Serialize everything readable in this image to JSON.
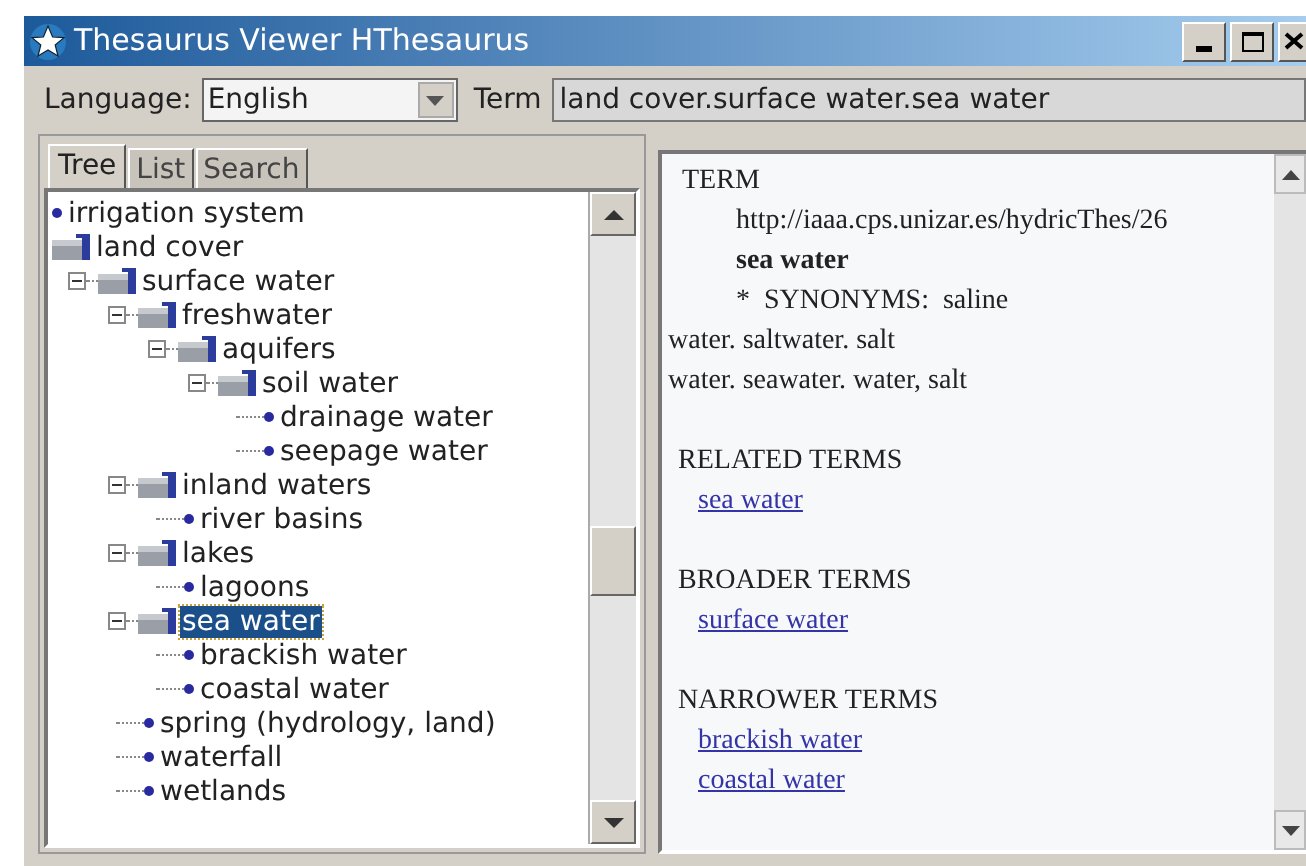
{
  "window": {
    "title": "Thesaurus Viewer HThesaurus"
  },
  "toolbar": {
    "language_label": "Language:",
    "language": "English",
    "term_label": "Term",
    "term": "land cover.surface water.sea water"
  },
  "tabs": [
    {
      "label": "Tree",
      "selected": true
    },
    {
      "label": "List",
      "selected": false
    },
    {
      "label": "Search",
      "selected": false
    }
  ],
  "tree": [
    {
      "label": "irrigation system",
      "kind": "leaf",
      "selected": false
    },
    {
      "label": "land cover",
      "kind": "folder",
      "selected": false,
      "children": [
        {
          "label": "surface water",
          "kind": "folder",
          "expanded": true,
          "selected": false,
          "children": [
            {
              "label": "freshwater",
              "kind": "folder",
              "expanded": true,
              "selected": false,
              "children": [
                {
                  "label": "aquifers",
                  "kind": "folder",
                  "expanded": true,
                  "selected": false,
                  "children": [
                    {
                      "label": "soil water",
                      "kind": "folder",
                      "expanded": true,
                      "selected": false,
                      "children": [
                        {
                          "label": "drainage water",
                          "kind": "leaf",
                          "selected": false
                        },
                        {
                          "label": "seepage water",
                          "kind": "leaf",
                          "selected": false
                        }
                      ]
                    }
                  ]
                }
              ]
            },
            {
              "label": "inland waters",
              "kind": "folder",
              "expanded": true,
              "selected": false,
              "children": [
                {
                  "label": "river basins",
                  "kind": "leaf",
                  "selected": false
                }
              ]
            },
            {
              "label": "lakes",
              "kind": "folder",
              "expanded": true,
              "selected": false,
              "children": [
                {
                  "label": "lagoons",
                  "kind": "leaf",
                  "selected": false
                }
              ]
            },
            {
              "label": "sea water",
              "kind": "folder",
              "expanded": true,
              "selected": true,
              "children": [
                {
                  "label": "brackish water",
                  "kind": "leaf",
                  "selected": false
                },
                {
                  "label": "coastal water",
                  "kind": "leaf",
                  "selected": false
                }
              ]
            },
            {
              "label": "spring (hydrology, land)",
              "kind": "leaf",
              "selected": false
            },
            {
              "label": "waterfall",
              "kind": "leaf",
              "selected": false
            },
            {
              "label": "wetlands",
              "kind": "leaf",
              "selected": false
            }
          ]
        }
      ]
    }
  ],
  "detail": {
    "heading": "TERM",
    "uri": "http://iaaa.cps.unizar.es/hydricThes/26",
    "term": "sea water",
    "synonyms_lines": [
      "*  SYNONYMS:  saline",
      "water. saltwater. salt",
      "water. seawater. water, salt"
    ],
    "sections": [
      {
        "heading": "RELATED TERMS",
        "links": [
          "sea water"
        ]
      },
      {
        "heading": "BROADER TERMS",
        "links": [
          "surface water"
        ]
      },
      {
        "heading": "NARROWER TERMS",
        "links": [
          "brackish water",
          "coastal water"
        ]
      }
    ]
  }
}
